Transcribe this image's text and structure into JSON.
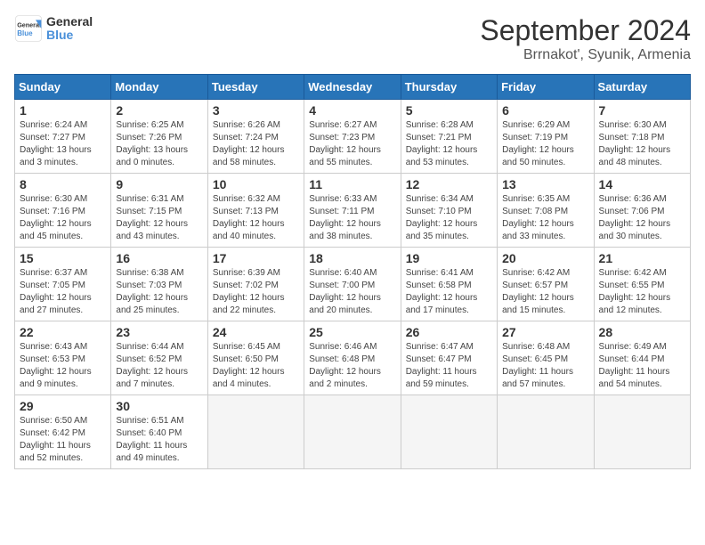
{
  "header": {
    "logo_general": "General",
    "logo_blue": "Blue",
    "title": "September 2024",
    "subtitle": "Brrnakot', Syunik, Armenia"
  },
  "calendar": {
    "days_of_week": [
      "Sunday",
      "Monday",
      "Tuesday",
      "Wednesday",
      "Thursday",
      "Friday",
      "Saturday"
    ],
    "weeks": [
      [
        {
          "day": 1,
          "sunrise": "6:24 AM",
          "sunset": "7:27 PM",
          "daylight": "13 hours and 3 minutes."
        },
        {
          "day": 2,
          "sunrise": "6:25 AM",
          "sunset": "7:26 PM",
          "daylight": "13 hours and 0 minutes."
        },
        {
          "day": 3,
          "sunrise": "6:26 AM",
          "sunset": "7:24 PM",
          "daylight": "12 hours and 58 minutes."
        },
        {
          "day": 4,
          "sunrise": "6:27 AM",
          "sunset": "7:23 PM",
          "daylight": "12 hours and 55 minutes."
        },
        {
          "day": 5,
          "sunrise": "6:28 AM",
          "sunset": "7:21 PM",
          "daylight": "12 hours and 53 minutes."
        },
        {
          "day": 6,
          "sunrise": "6:29 AM",
          "sunset": "7:19 PM",
          "daylight": "12 hours and 50 minutes."
        },
        {
          "day": 7,
          "sunrise": "6:30 AM",
          "sunset": "7:18 PM",
          "daylight": "12 hours and 48 minutes."
        }
      ],
      [
        {
          "day": 8,
          "sunrise": "6:30 AM",
          "sunset": "7:16 PM",
          "daylight": "12 hours and 45 minutes."
        },
        {
          "day": 9,
          "sunrise": "6:31 AM",
          "sunset": "7:15 PM",
          "daylight": "12 hours and 43 minutes."
        },
        {
          "day": 10,
          "sunrise": "6:32 AM",
          "sunset": "7:13 PM",
          "daylight": "12 hours and 40 minutes."
        },
        {
          "day": 11,
          "sunrise": "6:33 AM",
          "sunset": "7:11 PM",
          "daylight": "12 hours and 38 minutes."
        },
        {
          "day": 12,
          "sunrise": "6:34 AM",
          "sunset": "7:10 PM",
          "daylight": "12 hours and 35 minutes."
        },
        {
          "day": 13,
          "sunrise": "6:35 AM",
          "sunset": "7:08 PM",
          "daylight": "12 hours and 33 minutes."
        },
        {
          "day": 14,
          "sunrise": "6:36 AM",
          "sunset": "7:06 PM",
          "daylight": "12 hours and 30 minutes."
        }
      ],
      [
        {
          "day": 15,
          "sunrise": "6:37 AM",
          "sunset": "7:05 PM",
          "daylight": "12 hours and 27 minutes."
        },
        {
          "day": 16,
          "sunrise": "6:38 AM",
          "sunset": "7:03 PM",
          "daylight": "12 hours and 25 minutes."
        },
        {
          "day": 17,
          "sunrise": "6:39 AM",
          "sunset": "7:02 PM",
          "daylight": "12 hours and 22 minutes."
        },
        {
          "day": 18,
          "sunrise": "6:40 AM",
          "sunset": "7:00 PM",
          "daylight": "12 hours and 20 minutes."
        },
        {
          "day": 19,
          "sunrise": "6:41 AM",
          "sunset": "6:58 PM",
          "daylight": "12 hours and 17 minutes."
        },
        {
          "day": 20,
          "sunrise": "6:42 AM",
          "sunset": "6:57 PM",
          "daylight": "12 hours and 15 minutes."
        },
        {
          "day": 21,
          "sunrise": "6:42 AM",
          "sunset": "6:55 PM",
          "daylight": "12 hours and 12 minutes."
        }
      ],
      [
        {
          "day": 22,
          "sunrise": "6:43 AM",
          "sunset": "6:53 PM",
          "daylight": "12 hours and 9 minutes."
        },
        {
          "day": 23,
          "sunrise": "6:44 AM",
          "sunset": "6:52 PM",
          "daylight": "12 hours and 7 minutes."
        },
        {
          "day": 24,
          "sunrise": "6:45 AM",
          "sunset": "6:50 PM",
          "daylight": "12 hours and 4 minutes."
        },
        {
          "day": 25,
          "sunrise": "6:46 AM",
          "sunset": "6:48 PM",
          "daylight": "12 hours and 2 minutes."
        },
        {
          "day": 26,
          "sunrise": "6:47 AM",
          "sunset": "6:47 PM",
          "daylight": "11 hours and 59 minutes."
        },
        {
          "day": 27,
          "sunrise": "6:48 AM",
          "sunset": "6:45 PM",
          "daylight": "11 hours and 57 minutes."
        },
        {
          "day": 28,
          "sunrise": "6:49 AM",
          "sunset": "6:44 PM",
          "daylight": "11 hours and 54 minutes."
        }
      ],
      [
        {
          "day": 29,
          "sunrise": "6:50 AM",
          "sunset": "6:42 PM",
          "daylight": "11 hours and 52 minutes."
        },
        {
          "day": 30,
          "sunrise": "6:51 AM",
          "sunset": "6:40 PM",
          "daylight": "11 hours and 49 minutes."
        },
        null,
        null,
        null,
        null,
        null
      ]
    ]
  }
}
